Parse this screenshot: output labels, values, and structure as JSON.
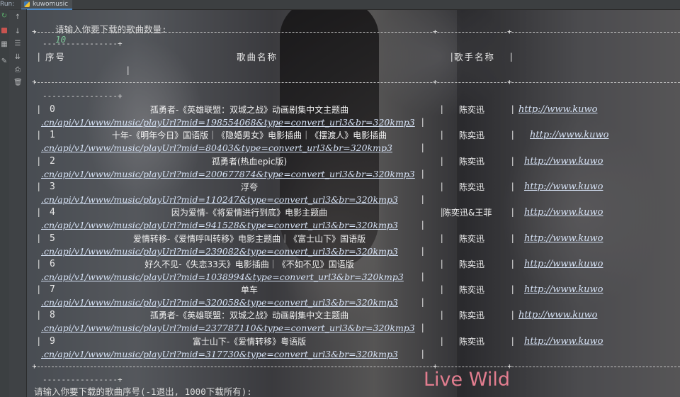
{
  "toolbar": {
    "run_label": "Run:",
    "tab_title": "kuwomusic"
  },
  "console": {
    "prompt_count_text": "请输入你要下载的歌曲数量:",
    "prompt_count_value": "10",
    "short_rule": "----------------+",
    "headers": {
      "index": "序号",
      "song": "歌曲名称",
      "singer": "歌手名称"
    },
    "url_prefix": "http://www.kuwo",
    "rows": [
      {
        "index": "0",
        "song": "孤勇者-《英雄联盟：双城之战》动画剧集中文主题曲",
        "singer": "陈奕迅",
        "url_tail": ".cn/api/v1/www/music/playUrl?mid=198554068&type=convert_url3&br=320kmp3"
      },
      {
        "index": "1",
        "song": "十年-《明年今日》国语版｜《隐婚男女》电影插曲｜《摆渡人》电影插曲",
        "singer": "陈奕迅",
        "url_tail": ".cn/api/v1/www/music/playUrl?mid=80403&type=convert_url3&br=320kmp3"
      },
      {
        "index": "2",
        "song": "孤勇者(热血epic版)",
        "singer": "陈奕迅",
        "url_tail": ".cn/api/v1/www/music/playUrl?mid=200677874&type=convert_url3&br=320kmp3"
      },
      {
        "index": "3",
        "song": "浮夸",
        "singer": "陈奕迅",
        "url_tail": ".cn/api/v1/www/music/playUrl?mid=110247&type=convert_url3&br=320kmp3"
      },
      {
        "index": "4",
        "song": "因为爱情-《将爱情进行到底》电影主题曲",
        "singer": "陈奕迅&王菲",
        "url_tail": ".cn/api/v1/www/music/playUrl?mid=941528&type=convert_url3&br=320kmp3"
      },
      {
        "index": "5",
        "song": "爱情转移-《爱情呼叫转移》电影主题曲｜《富士山下》国语版",
        "singer": "陈奕迅",
        "url_tail": ".cn/api/v1/www/music/playUrl?mid=239082&type=convert_url3&br=320kmp3"
      },
      {
        "index": "6",
        "song": "好久不见-《失恋33天》电影插曲｜《不如不见》国语版",
        "singer": "陈奕迅",
        "url_tail": ".cn/api/v1/www/music/playUrl?mid=1038994&type=convert_url3&br=320kmp3"
      },
      {
        "index": "7",
        "song": "单车",
        "singer": "陈奕迅",
        "url_tail": ".cn/api/v1/www/music/playUrl?mid=320058&type=convert_url3&br=320kmp3"
      },
      {
        "index": "8",
        "song": "孤勇者-《英雄联盟：双城之战》动画剧集中文主题曲",
        "singer": "陈奕迅",
        "url_tail": ".cn/api/v1/www/music/playUrl?mid=237787110&type=convert_url3&br=320kmp3"
      },
      {
        "index": "9",
        "song": "富士山下-《爱情转移》粤语版",
        "singer": "陈奕迅",
        "url_tail": ".cn/api/v1/www/music/playUrl?mid=317730&type=convert_url3&br=320kmp3"
      }
    ],
    "prompt_select_text": "请输入你要下载的歌曲序号(-1退出, 1000下载所有):"
  },
  "wallpaper_text": "Live Wild",
  "colors": {
    "prompt_value": "#7ec699",
    "link": "#d6e2f5",
    "accent_tab": "#4a88c7"
  }
}
